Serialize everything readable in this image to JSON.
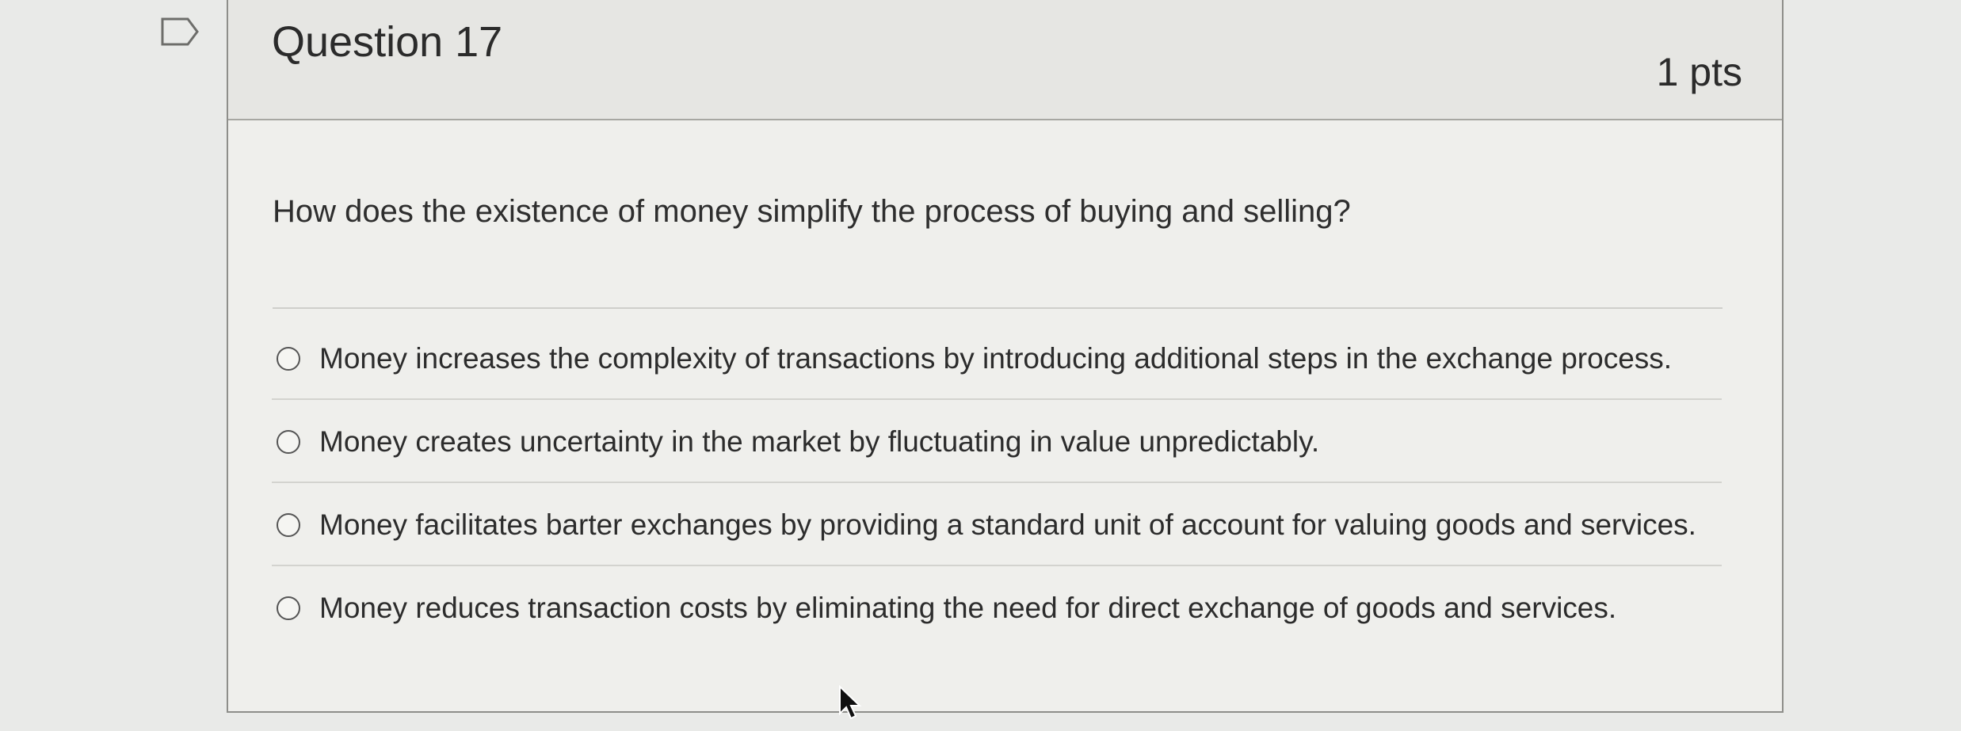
{
  "question": {
    "title": "Question 17",
    "points": "1 pts",
    "prompt": "How does the existence of money simplify the process of buying and selling?"
  },
  "answers": [
    {
      "label": "Money increases the complexity of transactions by introducing additional steps in the exchange process.",
      "selected": false
    },
    {
      "label": "Money creates uncertainty in the market by fluctuating in value unpredictably.",
      "selected": false
    },
    {
      "label": "Money facilitates barter exchanges by providing a standard unit of account for valuing goods and services.",
      "selected": false
    },
    {
      "label": "Money reduces transaction costs by eliminating the need for direct exchange of goods and services.",
      "selected": false
    }
  ],
  "icons": {
    "flag": "bookmark-flag-icon",
    "cursor": "mouse-pointer-icon"
  },
  "colors": {
    "background": "#e9eae8",
    "card": "#efefec",
    "header": "#e6e6e3",
    "text": "#2c2c2c"
  }
}
